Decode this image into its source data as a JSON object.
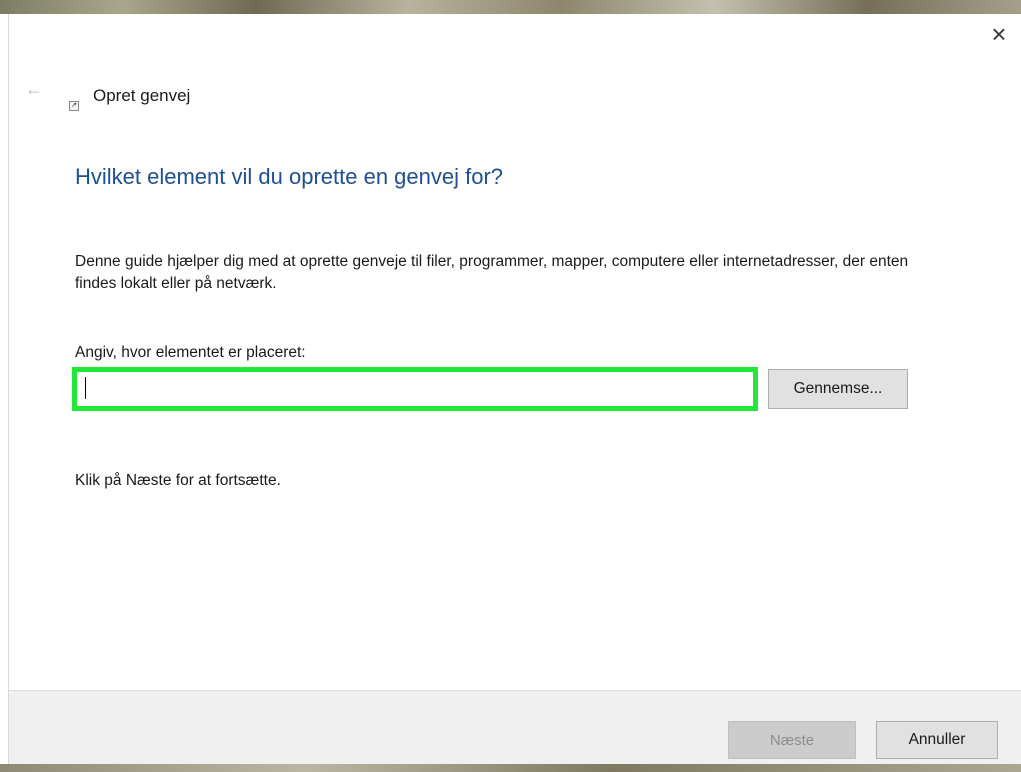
{
  "window": {
    "title": "Opret genvej",
    "close_glyph": "×",
    "back_glyph": "←",
    "shortcut_icon": "shortcut-icon"
  },
  "content": {
    "heading": "Hvilket element vil du oprette en genvej for?",
    "description": "Denne guide hjælper dig med at oprette genveje til filer, programmer, mapper, computere eller internetadresser, der enten findes lokalt eller på netværk.",
    "location_label": "Angiv, hvor elementet er placeret:",
    "location_value": "",
    "browse_label": "Gennemse...",
    "continue_hint": "Klik på Næste for at fortsætte."
  },
  "footer": {
    "next_label": "Næste",
    "cancel_label": "Annuller"
  },
  "colors": {
    "heading": "#1e4f95",
    "highlight": "#22e83a"
  }
}
